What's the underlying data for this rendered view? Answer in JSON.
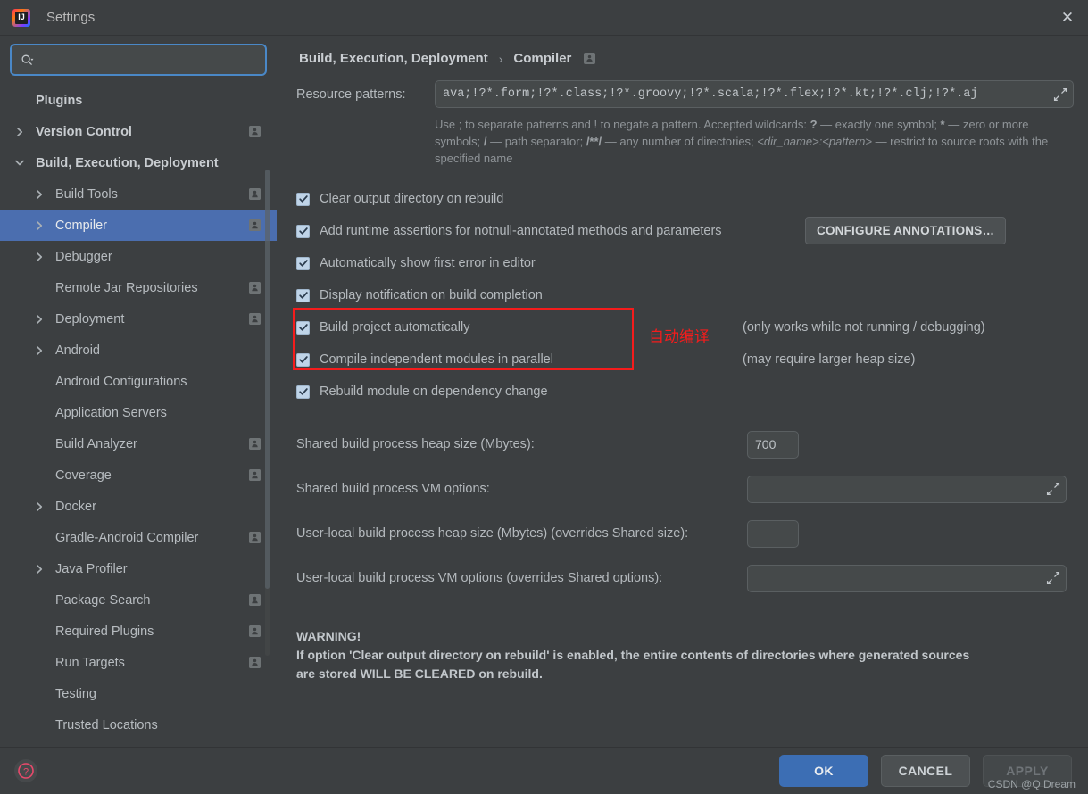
{
  "window": {
    "title": "Settings",
    "app_icon": "intellij-idea-icon",
    "close_label": "✕"
  },
  "sidebar": {
    "search": {
      "value": "",
      "placeholder": "",
      "icon": "search-icon"
    },
    "items": [
      {
        "label": "Plugins",
        "indent": 0,
        "arrow": "none",
        "bold": true,
        "badge": false,
        "selected": false
      },
      {
        "label": "Version Control",
        "indent": 0,
        "arrow": "collapsed",
        "bold": true,
        "badge": true,
        "selected": false
      },
      {
        "label": "Build, Execution, Deployment",
        "indent": 0,
        "arrow": "expanded",
        "bold": true,
        "badge": false,
        "selected": false
      },
      {
        "label": "Build Tools",
        "indent": 1,
        "arrow": "collapsed",
        "bold": false,
        "badge": true,
        "selected": false
      },
      {
        "label": "Compiler",
        "indent": 1,
        "arrow": "collapsed",
        "bold": false,
        "badge": true,
        "selected": true
      },
      {
        "label": "Debugger",
        "indent": 1,
        "arrow": "collapsed",
        "bold": false,
        "badge": false,
        "selected": false
      },
      {
        "label": "Remote Jar Repositories",
        "indent": 1,
        "arrow": "none",
        "bold": false,
        "badge": true,
        "selected": false
      },
      {
        "label": "Deployment",
        "indent": 1,
        "arrow": "collapsed",
        "bold": false,
        "badge": true,
        "selected": false
      },
      {
        "label": "Android",
        "indent": 1,
        "arrow": "collapsed",
        "bold": false,
        "badge": false,
        "selected": false
      },
      {
        "label": "Android Configurations",
        "indent": 1,
        "arrow": "none",
        "bold": false,
        "badge": false,
        "selected": false
      },
      {
        "label": "Application Servers",
        "indent": 1,
        "arrow": "none",
        "bold": false,
        "badge": false,
        "selected": false
      },
      {
        "label": "Build Analyzer",
        "indent": 1,
        "arrow": "none",
        "bold": false,
        "badge": true,
        "selected": false
      },
      {
        "label": "Coverage",
        "indent": 1,
        "arrow": "none",
        "bold": false,
        "badge": true,
        "selected": false
      },
      {
        "label": "Docker",
        "indent": 1,
        "arrow": "collapsed",
        "bold": false,
        "badge": false,
        "selected": false
      },
      {
        "label": "Gradle-Android Compiler",
        "indent": 1,
        "arrow": "none",
        "bold": false,
        "badge": true,
        "selected": false
      },
      {
        "label": "Java Profiler",
        "indent": 1,
        "arrow": "collapsed",
        "bold": false,
        "badge": false,
        "selected": false
      },
      {
        "label": "Package Search",
        "indent": 1,
        "arrow": "none",
        "bold": false,
        "badge": true,
        "selected": false
      },
      {
        "label": "Required Plugins",
        "indent": 1,
        "arrow": "none",
        "bold": false,
        "badge": true,
        "selected": false
      },
      {
        "label": "Run Targets",
        "indent": 1,
        "arrow": "none",
        "bold": false,
        "badge": true,
        "selected": false
      },
      {
        "label": "Testing",
        "indent": 1,
        "arrow": "none",
        "bold": false,
        "badge": false,
        "selected": false
      },
      {
        "label": "Trusted Locations",
        "indent": 1,
        "arrow": "none",
        "bold": false,
        "badge": false,
        "selected": false
      }
    ]
  },
  "breadcrumb": {
    "parent": "Build, Execution, Deployment",
    "separator": "›",
    "current": "Compiler",
    "badge": "project-scope-icon"
  },
  "nav": {
    "back_icon": "arrow-left-icon",
    "forward_icon": "arrow-right-icon"
  },
  "resource_patterns": {
    "label": "Resource patterns:",
    "value": "ava;!?*.form;!?*.class;!?*.groovy;!?*.scala;!?*.flex;!?*.kt;!?*.clj;!?*.aj",
    "expand_icon": "expand-icon",
    "hint_line1_a": "Use ; to separate patterns and ! to negate a pattern. Accepted wildcards: ",
    "hint_q": "?",
    "hint_line1_b": " — exactly one symbol; ",
    "hint_star": "*",
    "hint_line1_c": " — zero or",
    "hint_line2_a": "more symbols; ",
    "hint_slash": "/",
    "hint_line2_b": " — path separator; ",
    "hint_dirs": "/**/",
    "hint_line2_c": " — any number of directories;  ",
    "hint_dirname": "<dir_name>:<pattern>",
    "hint_line2_d": " — restrict to source",
    "hint_line3": "roots with the specified name"
  },
  "checkboxes": [
    {
      "label": "Clear output directory on rebuild",
      "checked": true,
      "accel": "l"
    },
    {
      "label": "Add runtime assertions for notnull-annotated methods and parameters",
      "checked": true,
      "accel": "a"
    },
    {
      "label": "Automatically show first error in editor",
      "checked": true,
      "accel": "e"
    },
    {
      "label": "Display notification on build completion",
      "checked": true,
      "accel": ""
    },
    {
      "label": "Build project automatically",
      "checked": true,
      "accel": ""
    },
    {
      "label": "Compile independent modules in parallel",
      "checked": true,
      "accel": ""
    },
    {
      "label": "Rebuild module on dependency change",
      "checked": true,
      "accel": ""
    }
  ],
  "configure_annotations_button": "CONFIGURE ANNOTATIONS…",
  "annotation": {
    "text": "自动编译",
    "color": "#f41c1c"
  },
  "side_notes": {
    "build_auto": "(only works while not running / debugging)",
    "parallel": "(may require larger heap size)"
  },
  "fields": [
    {
      "label": "Shared build process heap size (Mbytes):",
      "value": "700",
      "type": "small",
      "placeholder": ""
    },
    {
      "label": "Shared build process VM options:",
      "value": "",
      "type": "wide",
      "placeholder": ""
    },
    {
      "label": "User-local build process heap size (Mbytes) (overrides Shared size):",
      "value": "",
      "type": "small",
      "placeholder": ""
    },
    {
      "label": "User-local build process VM options (overrides Shared options):",
      "value": "",
      "type": "wide",
      "placeholder": ""
    }
  ],
  "warning": {
    "line1": "WARNING!",
    "line2": "If option 'Clear output directory on rebuild' is enabled, the entire contents of directories where generated sources",
    "line3": "are stored WILL BE CLEARED on rebuild."
  },
  "footer": {
    "help_icon": "help-question-icon",
    "ok": "OK",
    "cancel": "CANCEL",
    "apply": "APPLY",
    "watermark": "CSDN @Q Dream"
  },
  "colors": {
    "accent_blue": "#4b6eaf",
    "ok_blue": "#3c6eb4",
    "annotation_red": "#f41c1c",
    "bg": "#3c3f41",
    "field_bg": "#45494a"
  }
}
